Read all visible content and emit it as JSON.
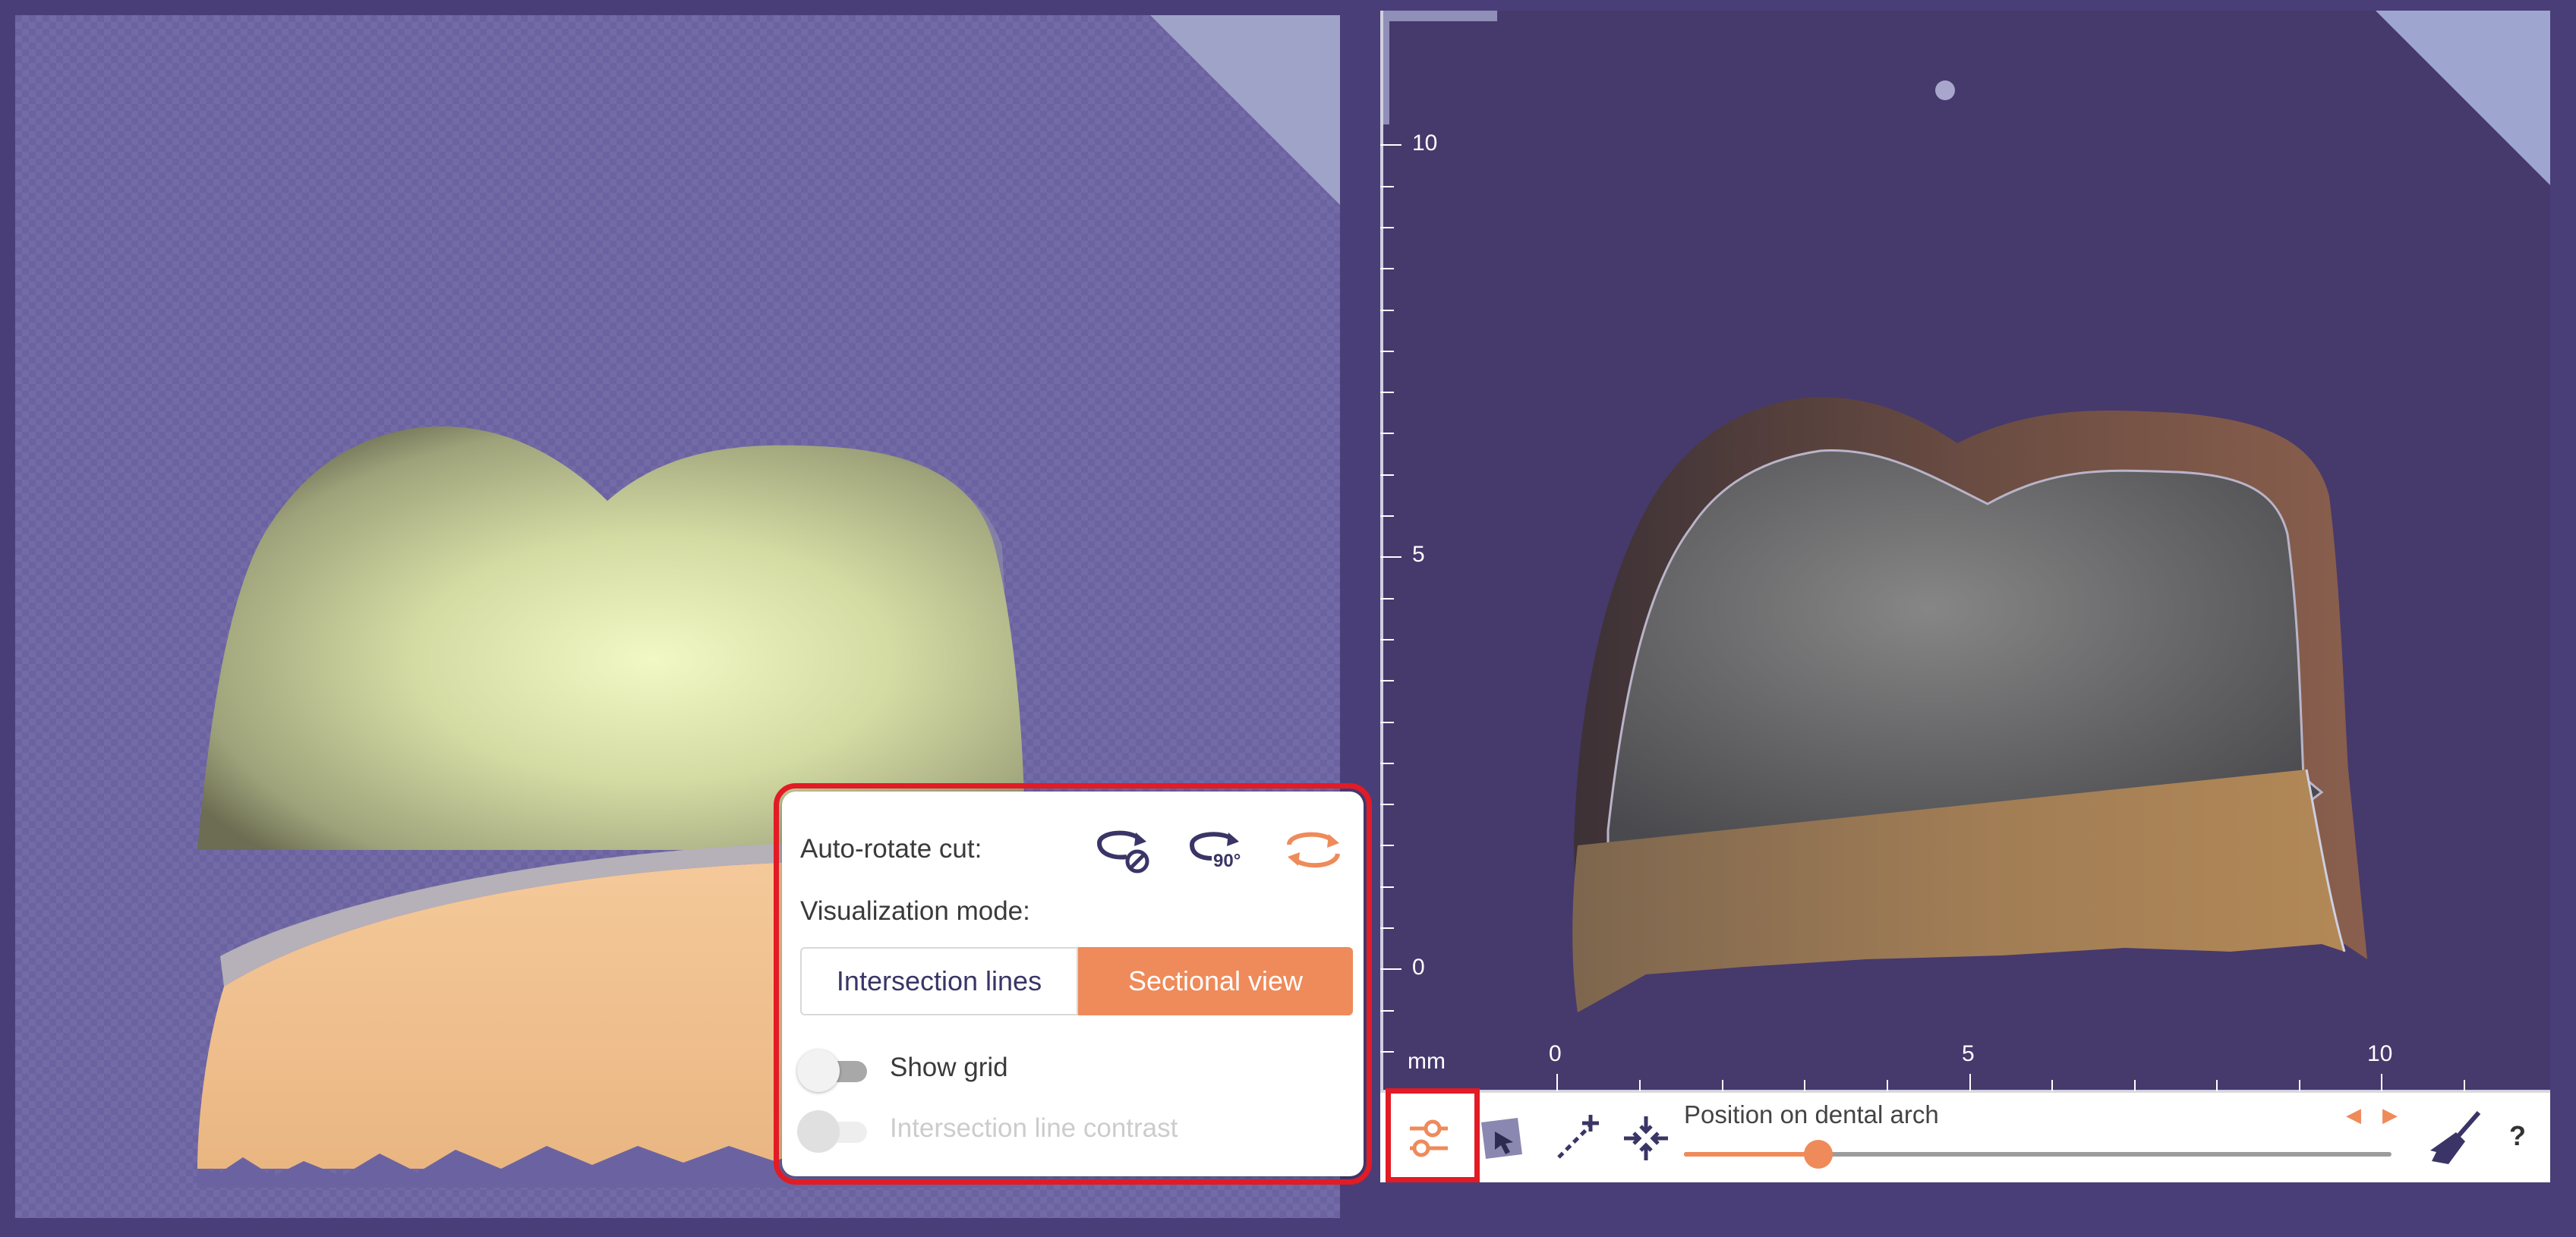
{
  "popup": {
    "auto_rotate_label": "Auto-rotate cut:",
    "rotate_90_label": "90°",
    "visualization_label": "Visualization mode:",
    "modes": [
      "Intersection lines",
      "Sectional view"
    ],
    "selected_mode": "Sectional view",
    "show_grid_label": "Show grid",
    "show_grid_on": false,
    "contrast_label": "Intersection line contrast",
    "contrast_enabled": false
  },
  "ruler": {
    "unit": "mm",
    "y_labels": [
      "10",
      "5",
      "0"
    ],
    "x_labels": [
      "0",
      "5",
      "10"
    ]
  },
  "toolbar": {
    "slider_label": "Position on dental arch",
    "slider_value_fraction": 0.19,
    "help_label": "?"
  },
  "icons": {
    "settings": "sliders-icon",
    "select": "hand-pointer-icon",
    "measure": "measure-line-icon",
    "center": "center-arrows-icon",
    "clear": "broom-icon"
  },
  "colors": {
    "accent": "#ef8a5a",
    "highlight": "#e21b24",
    "viewport_left": "#6b63a1",
    "viewport_right": "#46396c"
  }
}
